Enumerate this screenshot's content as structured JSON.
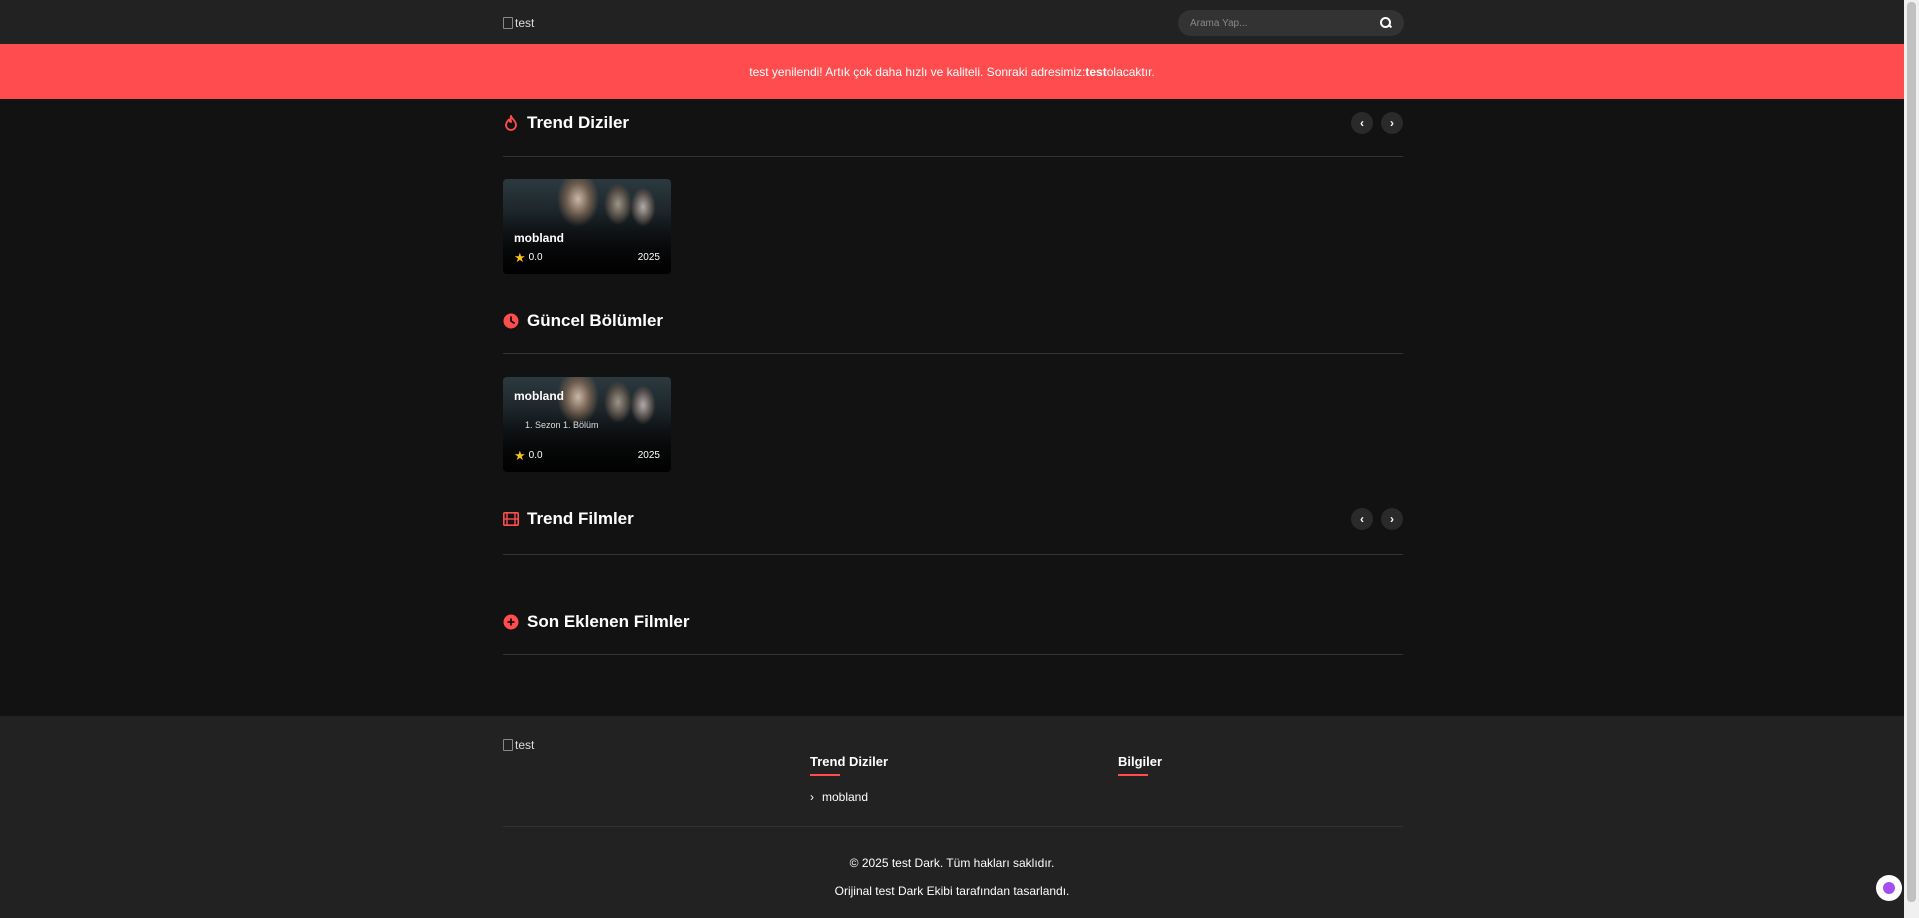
{
  "header": {
    "logo_alt": "test",
    "search_placeholder": "Arama Yap..."
  },
  "announcement": {
    "prefix": "test yenilendi! Artık çok daha hızlı ve kaliteli. Sonraki adresimiz: ",
    "bold": "test",
    "suffix": " olacaktır."
  },
  "sections": {
    "trend_series": {
      "title": "Trend Diziler"
    },
    "recent_episodes": {
      "title": "Güncel Bölümler"
    },
    "trend_movies": {
      "title": "Trend Filmler"
    },
    "latest_movies": {
      "title": "Son Eklenen Filmler"
    }
  },
  "cards": {
    "trend_series_card": {
      "title": "mobland",
      "rating": "0.0",
      "year": "2025"
    },
    "episode_card": {
      "title": "mobland",
      "episode": "1. Sezon 1. Bölüm",
      "rating": "0.0",
      "year": "2025"
    }
  },
  "arrows": {
    "prev": "‹",
    "next": "›"
  },
  "footer": {
    "logo_alt": "test",
    "col1_title": "Trend Diziler",
    "col1_link": "mobland",
    "col2_title": "Bilgiler",
    "copyright": "© 2025 test Dark. Tüm hakları saklıdır.",
    "credit": "Orijinal test Dark Ekibi tarafından tasarlandı."
  },
  "colors": {
    "accent": "#ff4d4f",
    "star": "#f7c21a"
  }
}
